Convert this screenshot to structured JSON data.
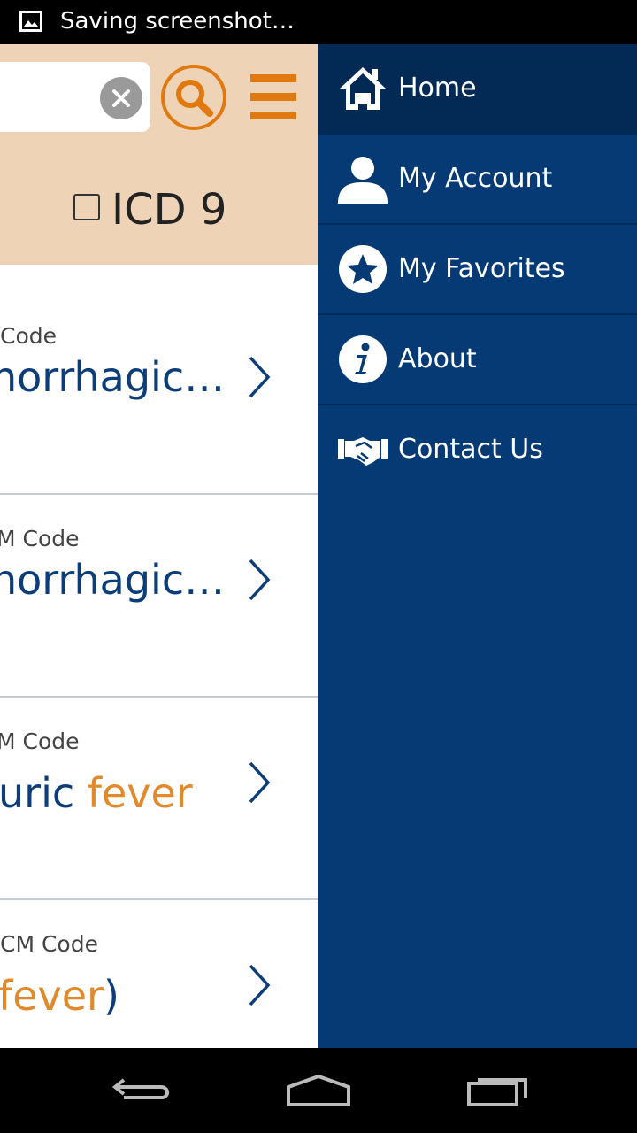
{
  "status_bar": {
    "text": "Saving screenshot…"
  },
  "header": {
    "search": {
      "value": "",
      "placeholder": ""
    },
    "icd_label": "ICD 9",
    "icd_checked": false
  },
  "results": [
    {
      "code_label": "Code",
      "title_main": "norrhagic…",
      "title_highlight": ""
    },
    {
      "code_label": "M Code",
      "title_main": "norrhagic…",
      "title_highlight": ""
    },
    {
      "code_label": "M Code",
      "title_main": "uric ",
      "title_highlight": "fever"
    },
    {
      "code_label": "CM Code",
      "title_main": "",
      "title_highlight": "fever",
      "title_tail": ")"
    }
  ],
  "drawer": {
    "items": [
      {
        "label": "Home",
        "icon": "home-icon"
      },
      {
        "label": "My Account",
        "icon": "user-icon"
      },
      {
        "label": "My Favorites",
        "icon": "star-icon"
      },
      {
        "label": "About",
        "icon": "info-icon"
      },
      {
        "label": "Contact Us",
        "icon": "handshake-icon"
      }
    ]
  },
  "colors": {
    "brand_orange": "#e07a10",
    "drawer_blue": "#053a75",
    "drawer_active": "#022a55",
    "header_bg": "#efd3b7",
    "title_blue": "#0d3d78",
    "highlight_orange": "#e08a2c"
  }
}
